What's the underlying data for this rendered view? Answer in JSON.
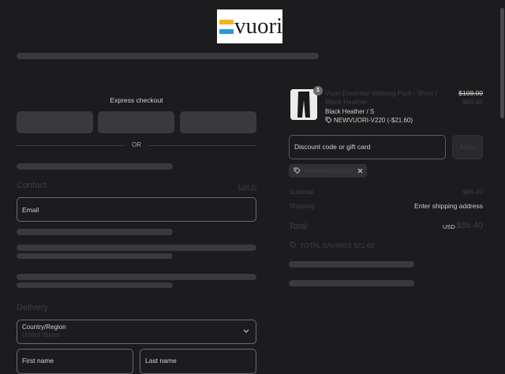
{
  "header": {
    "logo_text": "vuori",
    "logo_colors": [
      "#f5b321",
      "#ffffff",
      "#2b97d6"
    ]
  },
  "checkout": {
    "express_title": "Express checkout",
    "or_text": "OR",
    "contact_title": "Contact",
    "login_link": "Log in",
    "email_label": "Email",
    "delivery_title": "Delivery",
    "country_label": "Country/Region",
    "country_value": "United States",
    "first_name_label": "First name",
    "last_name_label": "Last name"
  },
  "summary": {
    "product": {
      "name": "Vuori Essential Wideleg Pant - Short | Black Heather",
      "variant": "Black Heather / S",
      "discount": "NEWVUORI-V220 (-$21.60)",
      "quantity": "1",
      "original_price": "$108.00",
      "price": "$86.40"
    },
    "discount_placeholder": "Discount code or gift card",
    "apply_label": "Apply",
    "applied_code": "NEWVUORI-V220",
    "subtotal_label": "Subtotal",
    "subtotal_value": "$86.40",
    "shipping_label": "Shipping",
    "shipping_value": "Enter shipping address",
    "total_label": "Total",
    "currency": "USD",
    "total_value": "$86.40",
    "savings_text": "TOTAL SAVINGS $21.60"
  },
  "colors": {
    "background": "#1c1c1f",
    "skeleton": "#3a3a3d",
    "field_border": "#6b6b70"
  }
}
